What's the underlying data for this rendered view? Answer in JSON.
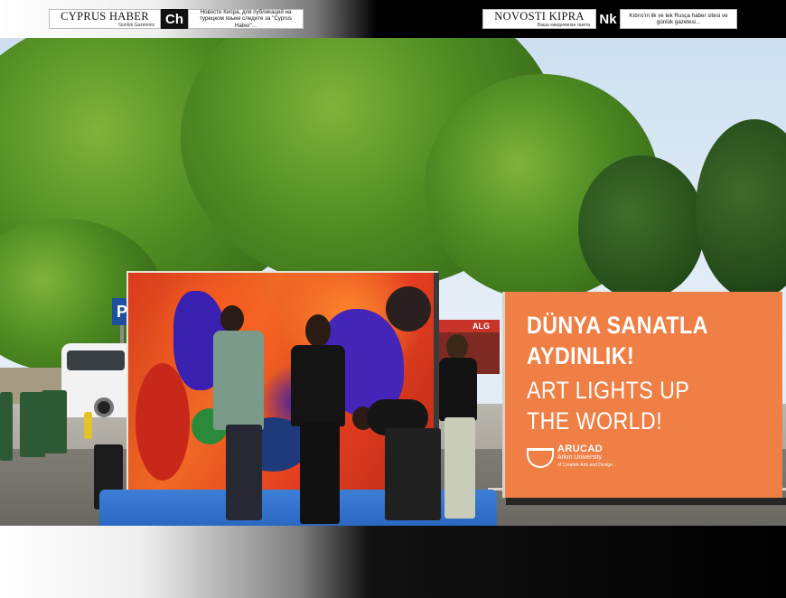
{
  "header": {
    "left": {
      "name": "CYPRUS HABER",
      "tagline": "Günlük Gazeteniz",
      "logo_text": "Ch",
      "description": "Новости Кипра, для публикаций на турецком языке следите за \"Cyprus Haber\"..."
    },
    "right": {
      "name": "NOVOSTI KIPRA",
      "tagline": "Ваша ежедневная газета",
      "logo_text": "Nk",
      "description": "Kıbrıs'ın ilk ve tek Rusça haber sitesi ve günlük gazetesi..."
    }
  },
  "photo": {
    "banner": {
      "line1": "DÜNYA SANATLA",
      "line2": "AYDINLIK!",
      "line3": "ART LIGHTS UP",
      "line4": "THE WORLD!",
      "logo_name": "ARUCAD",
      "logo_sub1": "Arkın University",
      "logo_sub2": "of Creative Arts and Design",
      "color": "#ef7f45"
    },
    "parking_sign": "P",
    "kiosk_sign": "ALG"
  }
}
